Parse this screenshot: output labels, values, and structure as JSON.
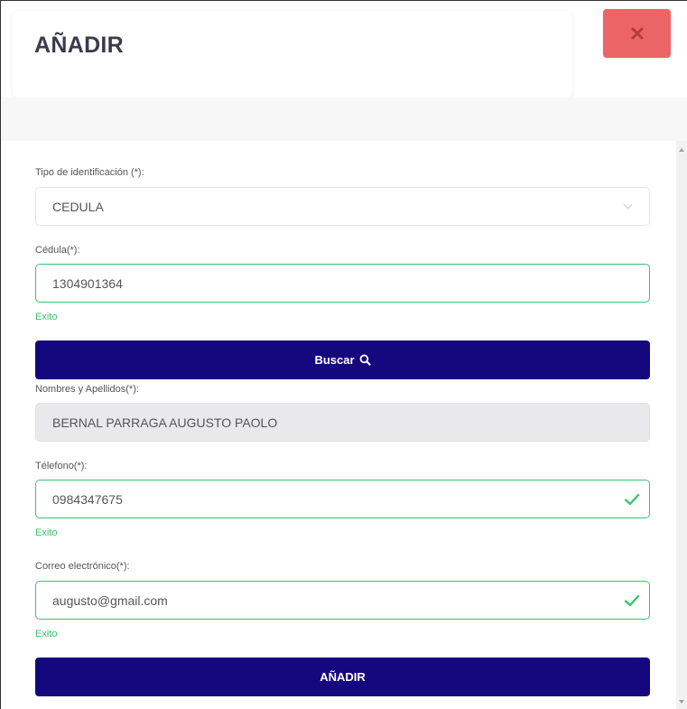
{
  "modal": {
    "title": "AÑADIR"
  },
  "form": {
    "id_type": {
      "label": "Tipo de identificación (*):",
      "value": "CEDULA"
    },
    "cedula": {
      "label": "Cédula(*):",
      "value": "1304901364",
      "feedback": "Exito"
    },
    "search_button": {
      "label": "Buscar"
    },
    "full_name": {
      "label": "Nombres y Apellidos(*):",
      "value": "BERNAL PARRAGA AUGUSTO PAOLO"
    },
    "phone": {
      "label": "Télefono(*):",
      "value": "0984347675",
      "feedback": "Exito"
    },
    "email": {
      "label": "Correo electrónico(*):",
      "value": "augusto@gmail.com",
      "feedback": "Exito"
    },
    "submit_button": {
      "label": "AÑADIR"
    }
  },
  "colors": {
    "primary": "#15077e",
    "danger": "#ec6566",
    "success": "#38c46c"
  },
  "icons": {
    "close": "close-icon",
    "search": "search-icon",
    "check": "check-icon",
    "dropdown": "chevron-down-icon"
  }
}
